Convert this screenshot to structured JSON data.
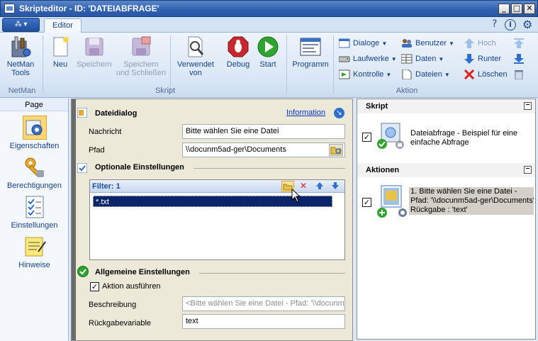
{
  "window": {
    "title": "Skripteditor - ID: 'DATEIABFRAGE'",
    "btn_minimize": "_",
    "btn_maximize": "□",
    "btn_close": "✕"
  },
  "ribbon": {
    "app_button_label": "▾",
    "tab_editor": "Editor",
    "help_glyph": "?",
    "info_glyph": "i",
    "netman": {
      "tools_label": "NetMan\nTools",
      "group_label": "NetMan"
    },
    "skript": {
      "neu": "Neu",
      "speichern": "Speichern",
      "speichern_schliessen": "Speichern\nund Schließen",
      "verwendet_von": "Verwendet\nvon",
      "debug": "Debug",
      "start": "Start",
      "group_label": "Skript"
    },
    "programm": "Programm",
    "aktion": {
      "dialoge": "Dialoge",
      "laufwerke": "Laufwerke",
      "kontrolle": "Kontrolle",
      "benutzer": "Benutzer",
      "daten": "Daten",
      "dateien": "Dateien",
      "hoch": "Hoch",
      "runter": "Runter",
      "loeschen": "Löschen",
      "group_label": "Aktion"
    }
  },
  "leftnav": {
    "header": "Page",
    "items": [
      {
        "label": "Eigenschaften",
        "icon": "gear-icon",
        "selected": true
      },
      {
        "label": "Berechtigungen",
        "icon": "key-icon",
        "selected": false
      },
      {
        "label": "Einstellungen",
        "icon": "checklist-icon",
        "selected": false
      },
      {
        "label": "Hinweise",
        "icon": "note-icon",
        "selected": false
      }
    ]
  },
  "dialog": {
    "title": "Dateidialog",
    "info_link": "Information",
    "nachricht_label": "Nachricht",
    "nachricht_value": "Bitte wählen Sie eine Datei",
    "pfad_label": "Pfad",
    "pfad_value": "\\\\docunm5ad-ger\\Documents",
    "optional_title": "Optionale Einstellungen",
    "filter_title": "Filter: 1",
    "filter_items": [
      "*.txt"
    ],
    "allgemein_title": "Allgemeine Einstellungen",
    "aktion_ausfuehren_label": "Aktion ausführen",
    "aktion_ausfuehren_checked": true,
    "beschreibung_label": "Beschreibung",
    "beschreibung_value": "<Bitte wählen Sie eine Datei - Pfad: '\\\\docunm",
    "rueckgabe_label": "Rückgabevariable",
    "rueckgabe_value": "text"
  },
  "rightpanel": {
    "skript_header": "Skript",
    "skript_item": "Dateiabfrage - Beispiel für eine einfache Abfrage",
    "aktionen_header": "Aktionen",
    "aktion_line1": "1. Bitte wählen Sie eine Datei -",
    "aktion_line2": "Pfad: '\\\\docunm5ad-ger\\Documents'",
    "aktion_line3": "Rückgabe : 'text'",
    "collapse_glyph": "−",
    "check_glyph": "✓"
  },
  "colors": {
    "accent": "#15428b",
    "selection": "#0a246a",
    "link": "#0033cc",
    "start_green": "#2fa52f",
    "debug_red": "#c8282d"
  }
}
